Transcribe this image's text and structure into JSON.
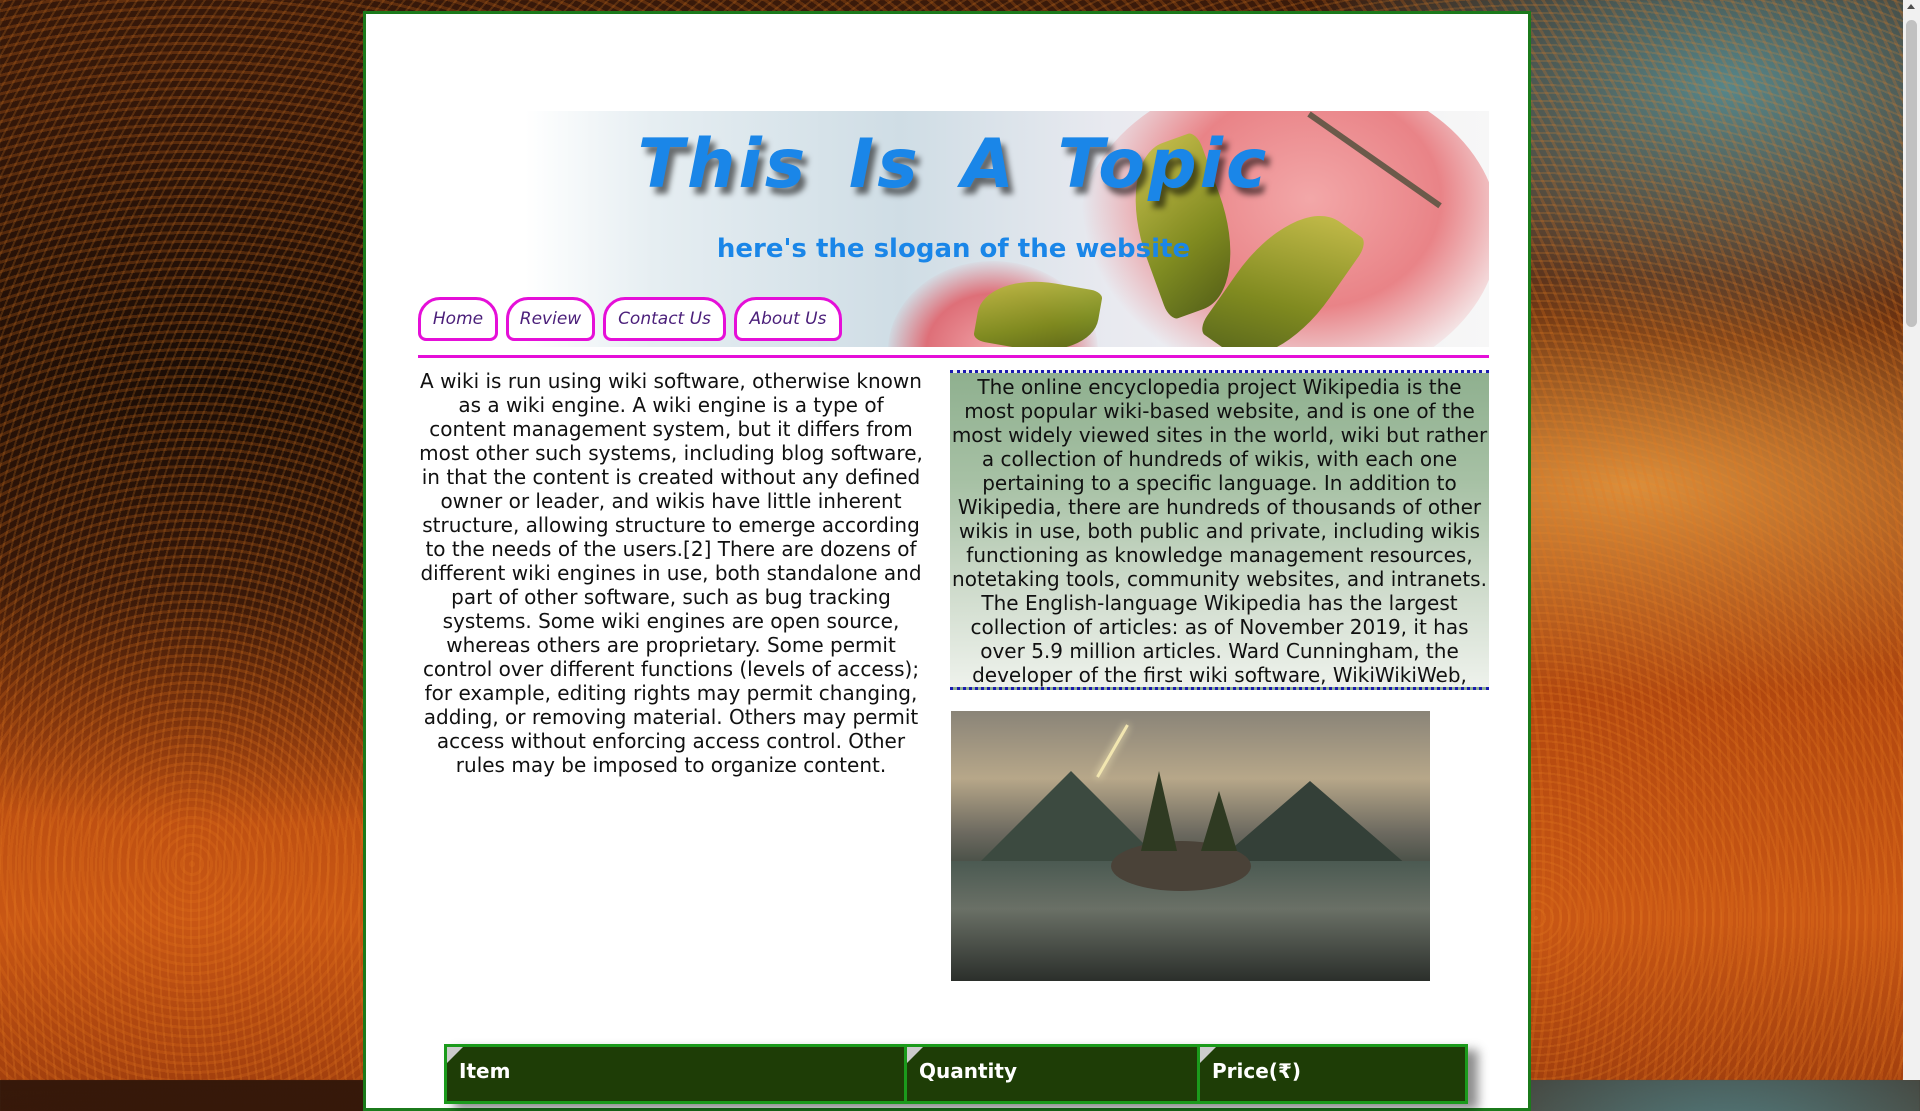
{
  "site": {
    "title": "This Is A Topic",
    "slogan": "here's the slogan of the website"
  },
  "nav": {
    "items": [
      {
        "label": "Home"
      },
      {
        "label": "Review"
      },
      {
        "label": "Contact Us"
      },
      {
        "label": "About Us"
      }
    ]
  },
  "content": {
    "left_text": "A wiki is run using wiki software, otherwise known as a wiki engine. A wiki engine is a type of content management system, but it differs from most other such systems, including blog software, in that the content is created without any defined owner or leader, and wikis have little inherent structure, allowing structure to emerge according to the needs of the users.[2] There are dozens of different wiki engines in use, both standalone and part of other software, such as bug tracking systems. Some wiki engines are open source, whereas others are proprietary. Some permit control over different functions (levels of access); for example, editing rights may permit changing, adding, or removing material. Others may permit access without enforcing access control. Other rules may be imposed to organize content.",
    "right_text": "The online encyclopedia project Wikipedia is the most popular wiki-based website, and is one of the most widely viewed sites in the world, wiki but rather a collection of hundreds of wikis, with each one pertaining to a specific language. In addition to Wikipedia, there are hundreds of thousands of other wikis in use, both public and private, including wikis functioning as knowledge management resources, notetaking tools, community websites, and intranets. The English-language Wikipedia has the largest collection of articles: as of November 2019, it has over 5.9 million articles. Ward Cunningham, the developer of the first wiki software, WikiWikiWeb,"
  },
  "table": {
    "headers": [
      "Item",
      "Quantity",
      "Price(₹)"
    ]
  },
  "colors": {
    "title": "#1a86e8",
    "nav_border": "#e50fd8",
    "nav_text": "#4b1f7a",
    "page_border": "#1b7a1b",
    "table_header_bg": "#1e3d06",
    "right_box_border": "#1a1ab0"
  }
}
